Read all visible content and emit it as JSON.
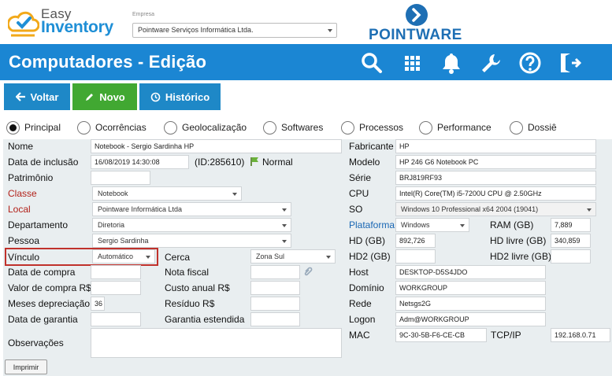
{
  "app": {
    "logo_line1": "Easy",
    "logo_line2": "Inventory",
    "brand": "POINTWARE"
  },
  "empresa": {
    "label": "Empresa",
    "value": "Pointware Serviços Informática Ltda."
  },
  "page": {
    "title": "Computadores - Edição"
  },
  "toolbar": {
    "back": "Voltar",
    "new": "Novo",
    "history": "Histórico"
  },
  "tabs": [
    "Principal",
    "Ocorrências",
    "Geolocalização",
    "Softwares",
    "Processos",
    "Performance",
    "Dossiê"
  ],
  "left": {
    "nome": {
      "label": "Nome",
      "value": "Notebook - Sergio Sardinha HP"
    },
    "inclusao": {
      "label": "Data de inclusão",
      "value": "16/08/2019 14:30:08",
      "id": "(ID:285610)",
      "status": "Normal"
    },
    "patrimonio": {
      "label": "Patrimônio",
      "value": ""
    },
    "classe": {
      "label": "Classe",
      "value": "Notebook"
    },
    "local": {
      "label": "Local",
      "value": "Pointware Informática Ltda"
    },
    "departamento": {
      "label": "Departamento",
      "value": "Diretoria"
    },
    "pessoa": {
      "label": "Pessoa",
      "value": "Sergio Sardinha"
    },
    "vinculo": {
      "label": "Vínculo",
      "value": "Automático"
    },
    "cerca": {
      "label": "Cerca",
      "value": "Zona Sul"
    },
    "data_compra": {
      "label": "Data de compra",
      "value": ""
    },
    "nota_fiscal": {
      "label": "Nota fiscal",
      "value": ""
    },
    "valor_compra": {
      "label": "Valor de compra R$",
      "value": ""
    },
    "custo_anual": {
      "label": "Custo anual R$",
      "value": ""
    },
    "meses_dep": {
      "label": "Meses depreciação",
      "value": "36"
    },
    "residuo": {
      "label": "Resíduo R$",
      "value": ""
    },
    "garantia": {
      "label": "Data de garantia",
      "value": ""
    },
    "garantia_est": {
      "label": "Garantia estendida",
      "value": ""
    },
    "observacoes": {
      "label": "Observações",
      "value": ""
    }
  },
  "right": {
    "fabricante": {
      "label": "Fabricante",
      "value": "HP"
    },
    "modelo": {
      "label": "Modelo",
      "value": "HP 246 G6 Notebook PC"
    },
    "serie": {
      "label": "Série",
      "value": "BRJ819RF93"
    },
    "cpu": {
      "label": "CPU",
      "value": "Intel(R) Core(TM) i5-7200U CPU @ 2.50GHz"
    },
    "so": {
      "label": "SO",
      "value": "Windows 10 Professional x64 2004 (19041)"
    },
    "plataforma": {
      "label": "Plataforma",
      "value": "Windows"
    },
    "ram": {
      "label": "RAM (GB)",
      "value": "7,889"
    },
    "hd": {
      "label": "HD (GB)",
      "value": "892,726"
    },
    "hd_livre": {
      "label": "HD livre (GB)",
      "value": "340,859"
    },
    "hd2": {
      "label": "HD2 (GB)",
      "value": ""
    },
    "hd2_livre": {
      "label": "HD2 livre (GB)",
      "value": ""
    },
    "host": {
      "label": "Host",
      "value": "DESKTOP-D5S4JDO"
    },
    "dominio": {
      "label": "Domínio",
      "value": "WORKGROUP"
    },
    "rede": {
      "label": "Rede",
      "value": "Netsgs2G"
    },
    "logon": {
      "label": "Logon",
      "value": "Adm@WORKGROUP"
    },
    "mac": {
      "label": "MAC",
      "value": "9C-30-5B-F6-CE-CB"
    },
    "tcpip": {
      "label": "TCP/IP",
      "value": "192.168.0.71"
    }
  },
  "footer": {
    "print": "Imprimir"
  },
  "colors": {
    "primary": "#1b86d3",
    "green": "#41a832",
    "label_red": "#b2221a",
    "label_blue": "#1866b3"
  }
}
